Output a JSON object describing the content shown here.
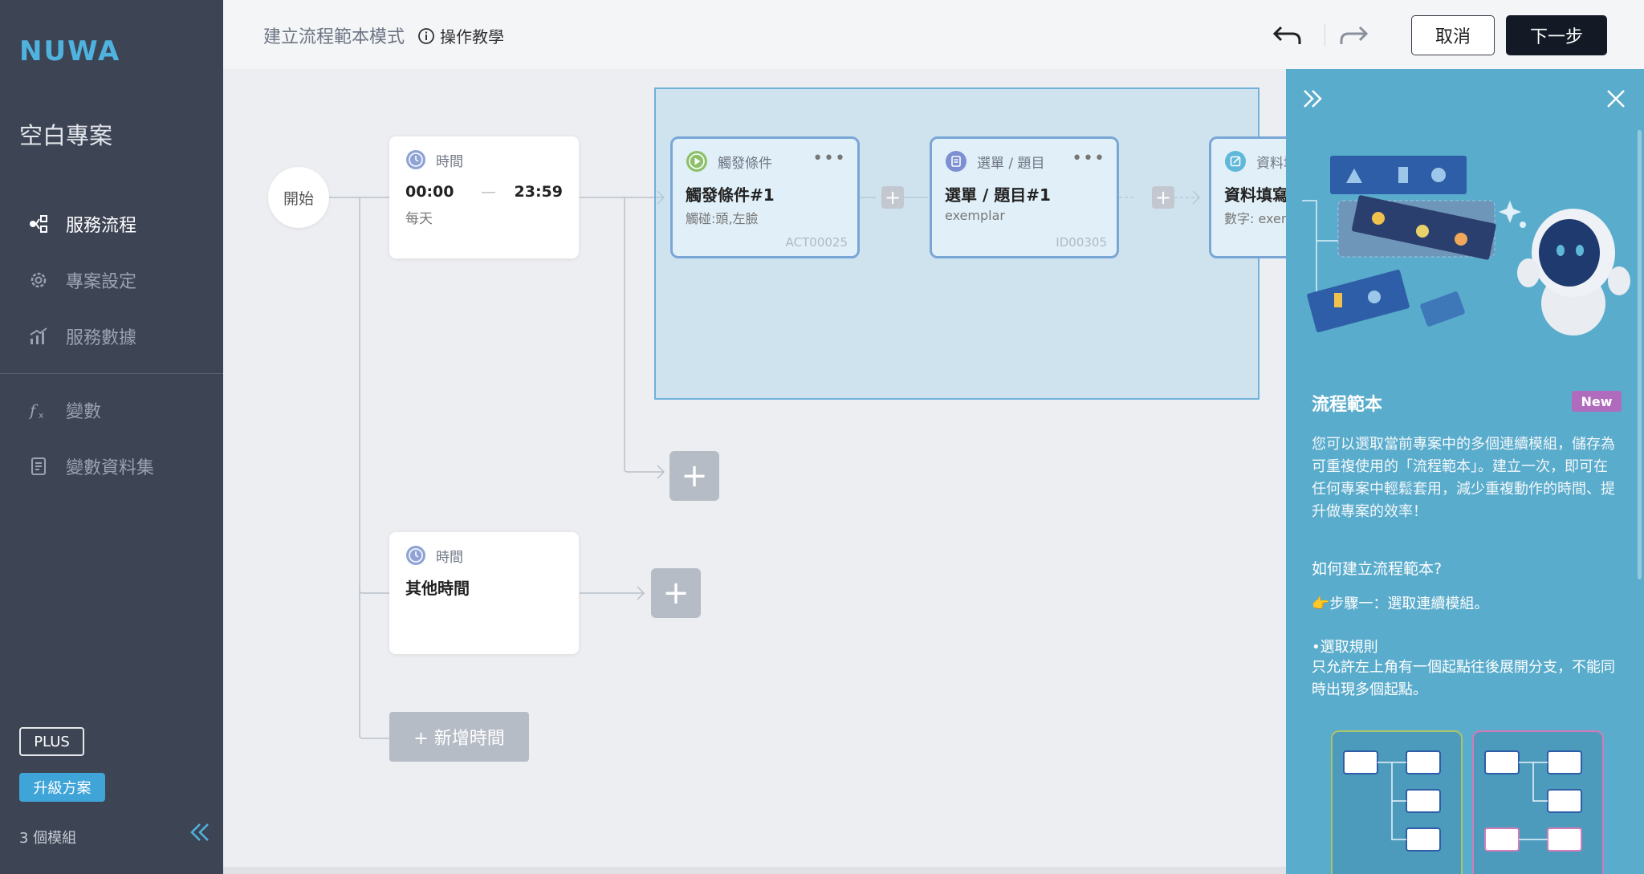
{
  "sidebar": {
    "logo": "NUWA",
    "project_name": "空白專案",
    "nav": [
      {
        "label": "服務流程",
        "icon": "flow-icon",
        "active": true
      },
      {
        "label": "專案設定",
        "icon": "gear-icon",
        "active": false
      },
      {
        "label": "服務數據",
        "icon": "chart-icon",
        "active": false
      },
      {
        "label": "變數",
        "icon": "function-icon",
        "active": false
      },
      {
        "label": "變數資料集",
        "icon": "document-icon",
        "active": false
      }
    ],
    "plan_badge": "PLUS",
    "upgrade_label": "升級方案",
    "modules_count": "3 個模組"
  },
  "topbar": {
    "mode_title": "建立流程範本模式",
    "tutorial_label": "操作教學",
    "cancel_label": "取消",
    "next_label": "下一步"
  },
  "canvas": {
    "start_label": "開始",
    "time_card": {
      "type": "時間",
      "start": "00:00",
      "separator": "—",
      "end": "23:59",
      "repeat": "每天"
    },
    "trigger_card": {
      "type": "觸發條件",
      "title": "觸發條件#1",
      "sub": "觸碰:頭,左臉",
      "code": "ACT00025"
    },
    "menu_card": {
      "type": "選單 / 題目",
      "title": "選單 / 題目#1",
      "sub": "exemplar",
      "code": "ID00305"
    },
    "data_card": {
      "type": "資料填寫",
      "title": "資料填寫",
      "sub": "數字: exemplar"
    },
    "other_time_card": {
      "type": "時間",
      "title": "其他時間"
    },
    "add_time_label": "+ 新增時間",
    "more_label": "•••"
  },
  "panel": {
    "title": "流程範本",
    "new_badge": "New",
    "description": "您可以選取當前專案中的多個連續模組，儲存為可重複使用的「流程範本」。建立一次，即可在任何專案中輕鬆套用，減少重複動作的時間、提升做專案的效率！",
    "how_title": "如何建立流程範本?",
    "step_one": "👉步驟一：選取連續模組。",
    "rule_title": "•選取規則",
    "rule_desc": "只允許左上角有一個起點往後展開分支，不能同時出現多個起點。"
  },
  "colors": {
    "sidebar_bg": "#3d4555",
    "accent": "#3fa4d8",
    "panel_bg": "#5aaccc",
    "new_badge": "#b06bbd",
    "next_button": "#131a26",
    "card_border": "#7aa6d6"
  }
}
